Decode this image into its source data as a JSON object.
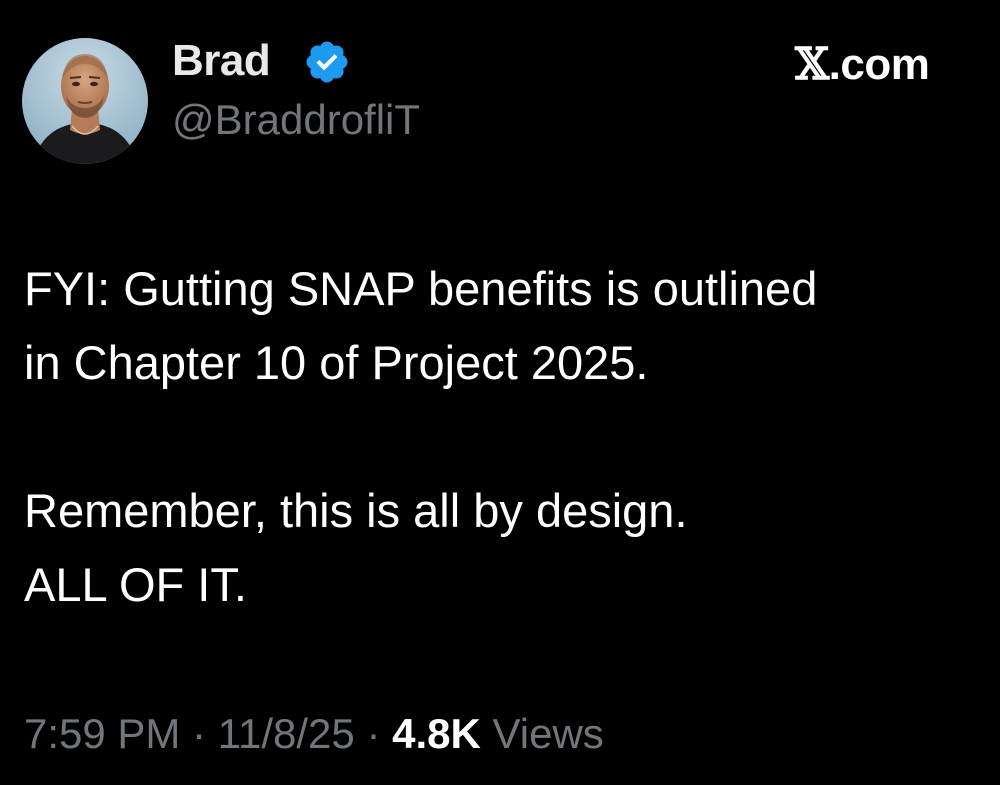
{
  "author": {
    "name": "Brad",
    "handle": "@BraddrofliT",
    "verified": true,
    "badge_color": "#1d9bf0"
  },
  "site": {
    "brand_letter": "𝕏",
    "brand_suffix": ".com"
  },
  "tweet": {
    "lines": [
      "FYI: Gutting SNAP benefits is outlined",
      "in Chapter 10 of Project 2025.",
      "",
      "Remember, this is all by design.",
      "ALL OF IT."
    ]
  },
  "meta": {
    "time": "7:59 PM",
    "separator": "·",
    "date": "11/8/25",
    "views_count": "4.8K",
    "views_label": "Views"
  },
  "colors": {
    "background": "#000000",
    "text": "#ffffff",
    "secondary_text": "#71767b"
  }
}
